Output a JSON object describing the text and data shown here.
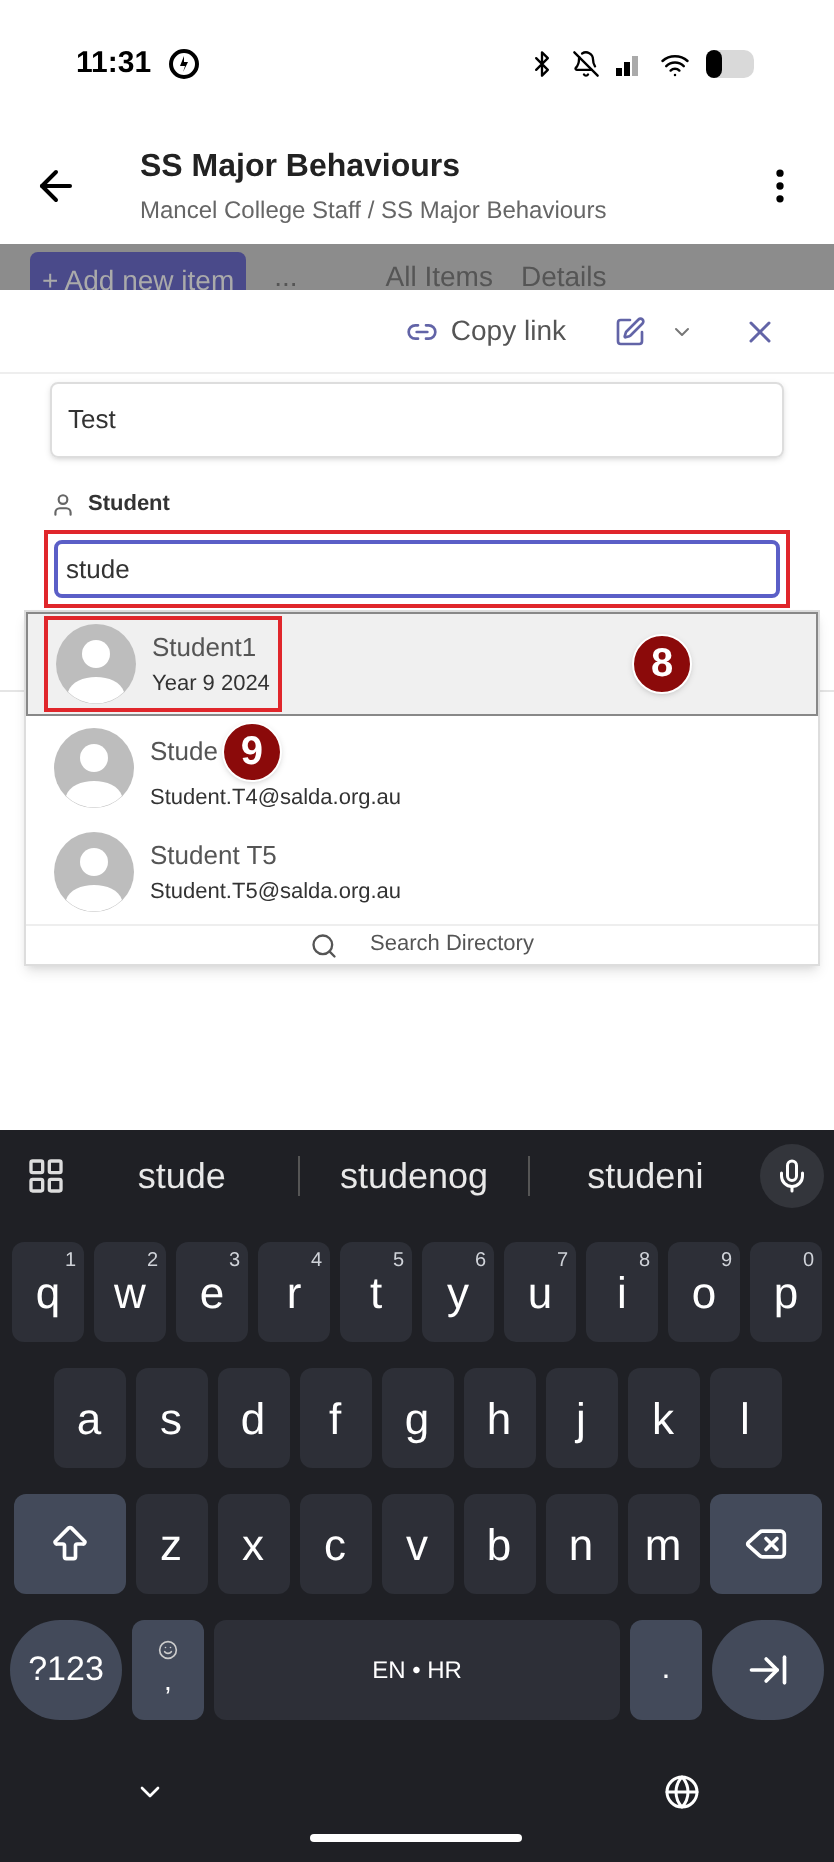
{
  "status_bar": {
    "time": "11:31"
  },
  "header": {
    "title": "SS Major Behaviours",
    "breadcrumb": "Mancel College Staff / SS Major Behaviours"
  },
  "toolbar": {
    "add_button": "+ Add new item",
    "more": "...",
    "view": "All Items",
    "details": "Details"
  },
  "panel": {
    "copy_link": "Copy link",
    "title_value": "Test",
    "student_label": "Student",
    "student_input": "stude",
    "input_highlighted": true
  },
  "suggestions": [
    {
      "name": "Student1",
      "detail": "Year 9 2024",
      "selected": true,
      "highlighted": true,
      "callout": "8"
    },
    {
      "name": "Stude",
      "detail": "Student.T4@salda.org.au",
      "selected": false,
      "highlighted": false,
      "callout": "9"
    },
    {
      "name": "Student T5",
      "detail": "Student.T5@salda.org.au",
      "selected": false,
      "highlighted": false
    }
  ],
  "search_directory": "Search Directory",
  "keyboard": {
    "predictions": [
      "stude",
      "studenog",
      "studeni"
    ],
    "rows": [
      [
        {
          "label": "q",
          "hint": "1"
        },
        {
          "label": "w",
          "hint": "2"
        },
        {
          "label": "e",
          "hint": "3"
        },
        {
          "label": "r",
          "hint": "4"
        },
        {
          "label": "t",
          "hint": "5"
        },
        {
          "label": "y",
          "hint": "6"
        },
        {
          "label": "u",
          "hint": "7"
        },
        {
          "label": "i",
          "hint": "8"
        },
        {
          "label": "o",
          "hint": "9"
        },
        {
          "label": "p",
          "hint": "0"
        }
      ],
      [
        {
          "label": "a"
        },
        {
          "label": "s"
        },
        {
          "label": "d"
        },
        {
          "label": "f"
        },
        {
          "label": "g"
        },
        {
          "label": "h"
        },
        {
          "label": "j"
        },
        {
          "label": "k"
        },
        {
          "label": "l"
        }
      ],
      [
        {
          "kind": "shift"
        },
        {
          "label": "z"
        },
        {
          "label": "x"
        },
        {
          "label": "c"
        },
        {
          "label": "v"
        },
        {
          "label": "b"
        },
        {
          "label": "n"
        },
        {
          "label": "m"
        },
        {
          "kind": "backspace"
        }
      ]
    ],
    "symbols": "?123",
    "comma": ",",
    "space": "EN • HR",
    "period": "."
  }
}
